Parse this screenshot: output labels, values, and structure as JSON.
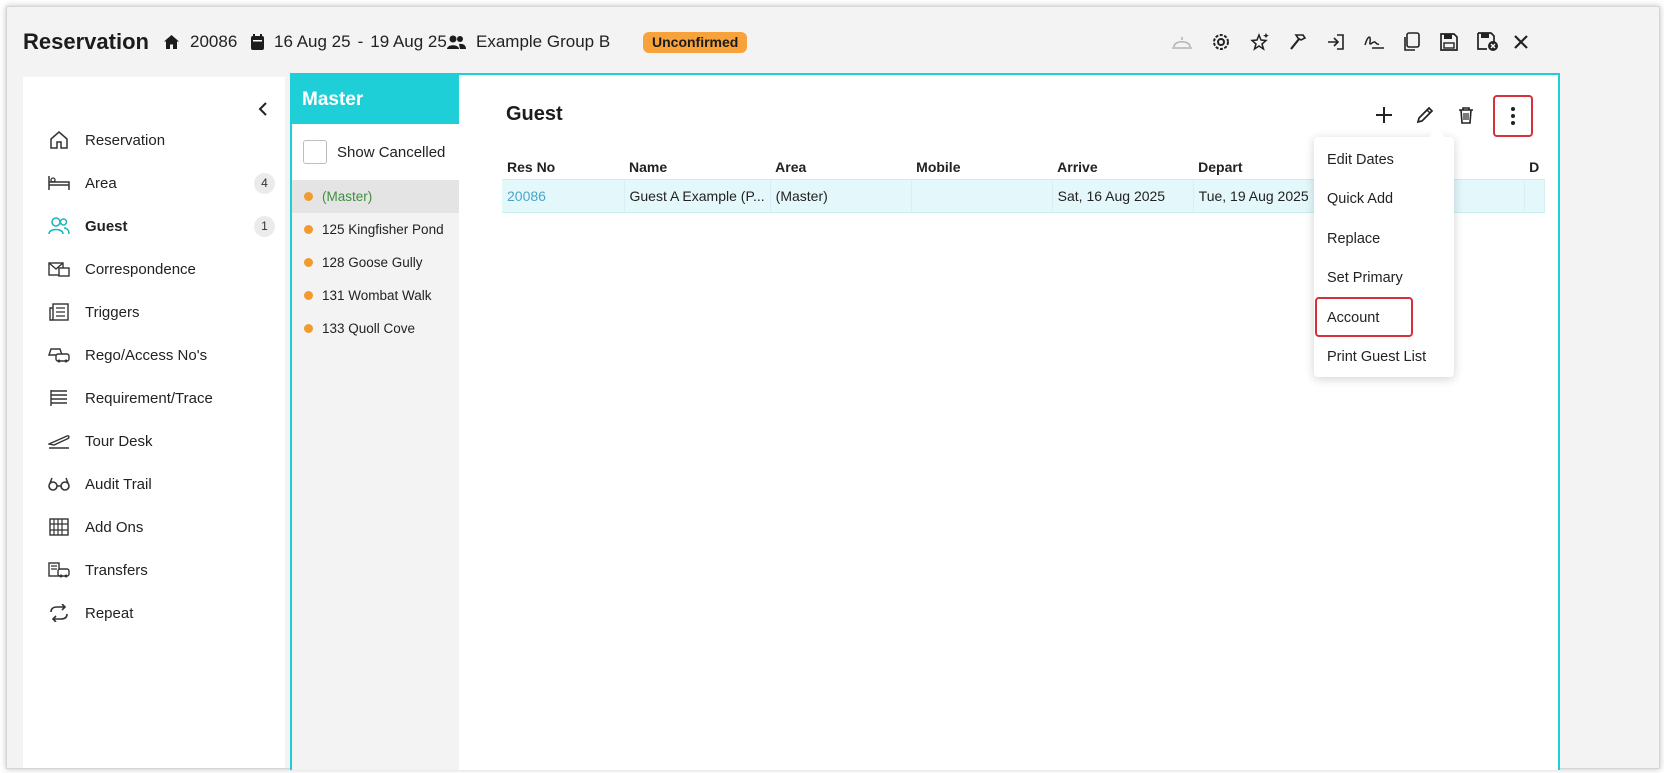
{
  "header": {
    "title": "Reservation",
    "res_no": "20086",
    "date_from": "16 Aug 25",
    "date_sep": "-",
    "date_to": "19 Aug 25",
    "group": "Example Group B",
    "status": "Unconfirmed",
    "status_color": "#f7a23a"
  },
  "sidebar": {
    "items": [
      {
        "label": "Reservation",
        "icon": "home-icon"
      },
      {
        "label": "Area",
        "icon": "bed-icon",
        "count": "4"
      },
      {
        "label": "Guest",
        "icon": "users-icon",
        "count": "1",
        "active": true
      },
      {
        "label": "Correspondence",
        "icon": "mail-icon"
      },
      {
        "label": "Triggers",
        "icon": "newspaper-icon"
      },
      {
        "label": "Rego/Access No's",
        "icon": "car-icon"
      },
      {
        "label": "Requirement/Trace",
        "icon": "list-icon"
      },
      {
        "label": "Tour Desk",
        "icon": "plane-icon"
      },
      {
        "label": "Audit Trail",
        "icon": "glasses-icon"
      },
      {
        "label": "Add Ons",
        "icon": "grid-icon"
      },
      {
        "label": "Transfers",
        "icon": "bus-icon"
      },
      {
        "label": "Repeat",
        "icon": "repeat-icon"
      }
    ]
  },
  "master": {
    "title": "Master",
    "show_cancelled": "Show Cancelled",
    "items": [
      "(Master)",
      "125 Kingfisher Pond",
      "128 Goose Gully",
      "131 Wombat Walk",
      "133 Quoll Cove"
    ]
  },
  "guest": {
    "title": "Guest",
    "columns": [
      "Res No",
      "Name",
      "Area",
      "Mobile",
      "Arrive",
      "Depart",
      "D"
    ],
    "rows": [
      {
        "res_no": "20086",
        "name": "Guest A Example (P...",
        "area": "(Master)",
        "mobile": "",
        "arrive": "Sat, 16 Aug 2025",
        "depart": "Tue, 19 Aug 2025"
      }
    ]
  },
  "menu": {
    "items": [
      "Edit Dates",
      "Quick Add",
      "Replace",
      "Set Primary",
      "Account",
      "Print Guest List"
    ],
    "highlight_color": "#d6303b"
  },
  "colors": {
    "accent": "#1fcfd8",
    "dot": "#f39a2e"
  }
}
